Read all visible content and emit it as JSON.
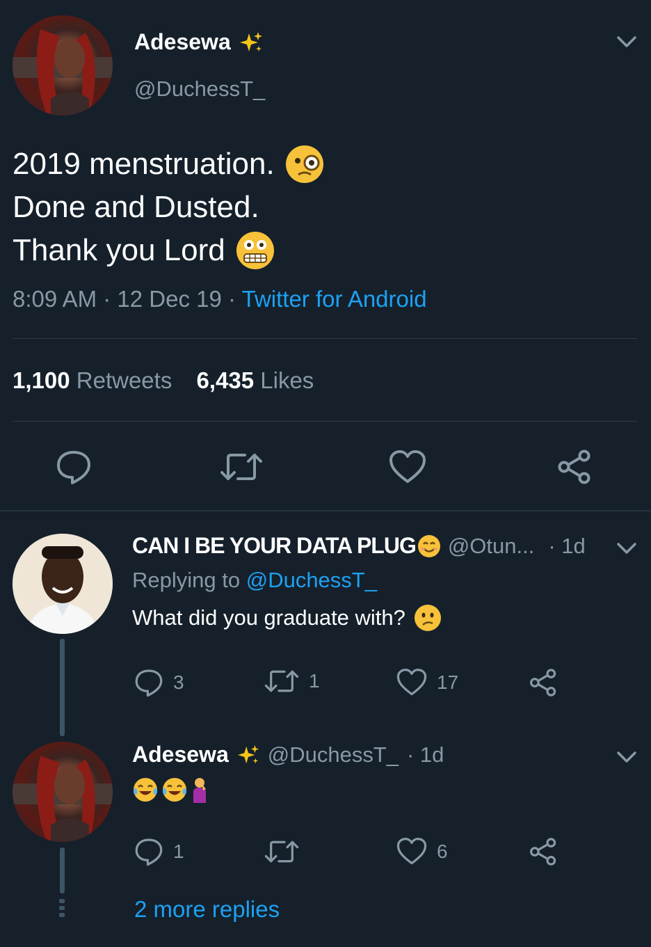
{
  "main_tweet": {
    "author_name": "Adesewa",
    "author_handle": "@DuchessT_",
    "badge_icon": "sparkles-icon",
    "text_lines": [
      "2019 menstruation.",
      "Done and Dusted.",
      "Thank you Lord"
    ],
    "line1_emoji": "face-with-monocle-icon",
    "line3_emoji": "grimacing-face-icon",
    "time": "8:09 AM",
    "date": "12 Dec 19",
    "sep": "·",
    "source": "Twitter for Android",
    "retweets_count": "1,100",
    "retweets_label": "Retweets",
    "likes_count": "6,435",
    "likes_label": "Likes"
  },
  "reply1": {
    "author_name": "CAN I BE YOUR DATA PLUG",
    "name_emoji": "smiling-face-icon",
    "author_handle": "@Otun...",
    "time": "· 1d",
    "replying_prefix": "Replying to",
    "replying_handle": "@DuchessT_",
    "text": "What did you graduate with?",
    "text_emoji": "confused-face-icon",
    "reply_count": "3",
    "retweet_count": "1",
    "like_count": "17"
  },
  "reply2": {
    "author_name": "Adesewa",
    "author_handle": "@DuchessT_",
    "time": "· 1d",
    "text_emojis": [
      "tears-of-joy-icon",
      "tears-of-joy-icon",
      "person-facepalming-icon"
    ],
    "reply_count": "1",
    "like_count": "6"
  },
  "more_replies": "2 more replies",
  "colors": {
    "background": "#15202b",
    "muted": "#8899a6",
    "link": "#1da1f2",
    "divider": "#2f3d4a"
  }
}
